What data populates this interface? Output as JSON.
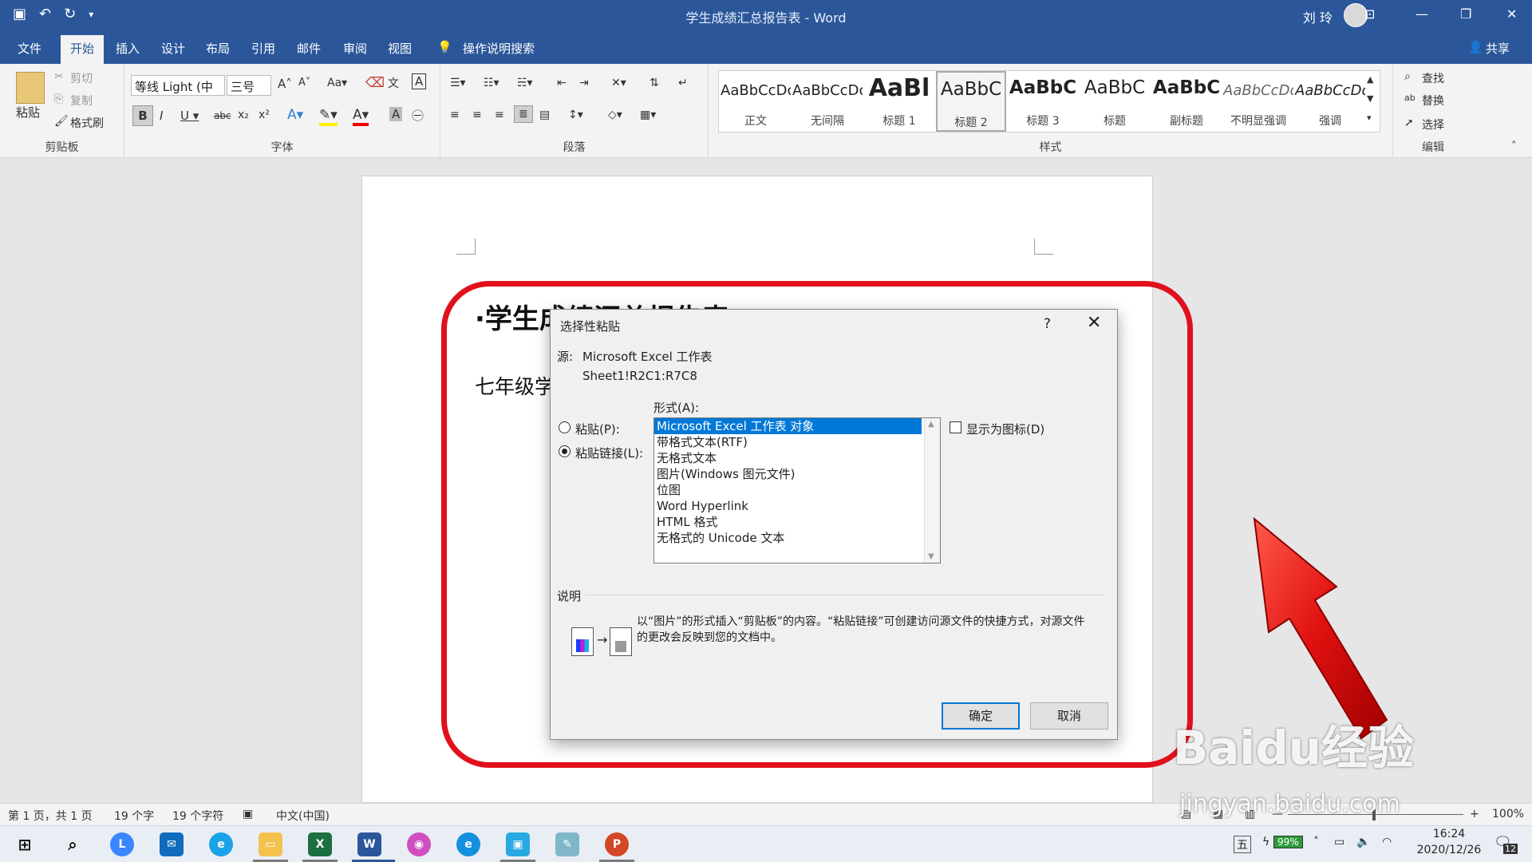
{
  "title_bar": {
    "title": "学生成绩汇总报告表  -  Word",
    "user": "刘 玲"
  },
  "tabs": [
    "文件",
    "开始",
    "插入",
    "设计",
    "布局",
    "引用",
    "邮件",
    "审阅",
    "视图",
    "操作说明搜索"
  ],
  "share_label": "共享",
  "ribbon": {
    "clipboard": {
      "paste": "粘贴",
      "cut": "剪切",
      "copy": "复制",
      "format_painter": "格式刷",
      "label": "剪贴板"
    },
    "font": {
      "name": "等线 Light (中",
      "size": "三号",
      "label": "字体"
    },
    "paragraph": {
      "label": "段落"
    },
    "styles": {
      "label": "样式",
      "items": [
        {
          "preview": "AaBbCcDc",
          "name": "正文"
        },
        {
          "preview": "AaBbCcDc",
          "name": "无间隔"
        },
        {
          "preview": "AaBl",
          "name": "标题 1"
        },
        {
          "preview": "AaBbC",
          "name": "标题 2"
        },
        {
          "preview": "AaBbC",
          "name": "标题 3"
        },
        {
          "preview": "AaBbC",
          "name": "标题"
        },
        {
          "preview": "AaBbC",
          "name": "副标题"
        },
        {
          "preview": "AaBbCcDc",
          "name": "不明显强调"
        },
        {
          "preview": "AaBbCcDc",
          "name": "强调"
        }
      ]
    },
    "editing": {
      "find": "查找",
      "replace": "替换",
      "select": "选择",
      "label": "编辑"
    }
  },
  "document": {
    "heading": "·学生成绩汇总报告表",
    "line2": "七年级学"
  },
  "dialog": {
    "title": "选择性粘贴",
    "help": "?",
    "source_label": "源:",
    "source_app": "Microsoft Excel 工作表",
    "source_range": "Sheet1!R2C1:R7C8",
    "format_label": "形式(A):",
    "paste_label": "粘贴(P):",
    "paste_link_label": "粘贴链接(L):",
    "formats": [
      "Microsoft Excel 工作表 对象",
      "带格式文本(RTF)",
      "无格式文本",
      "图片(Windows 图元文件)",
      "位图",
      "Word Hyperlink",
      "HTML 格式",
      "无格式的 Unicode 文本"
    ],
    "show_as_icon": "显示为图标(D)",
    "result_title": "说明",
    "result_text_1": "以“图片”的形式插入“剪贴板”的内容。“粘贴链接”可创建访问源文件的快捷方式，对源文件",
    "result_text_2": "的更改会反映到您的文档中。",
    "ok": "确定",
    "cancel": "取消"
  },
  "status_bar": {
    "page": "第 1 页，共 1 页",
    "words": "19 个字",
    "chars": "19 个字符",
    "lang": "中文(中国)",
    "zoom": "100%"
  },
  "taskbar": {
    "ime": "五",
    "battery": "99%",
    "time": "16:24",
    "date": "2020/12/26",
    "notifications": "12"
  },
  "watermark": {
    "brand": "Baidu经验",
    "url": "jingyan.baidu.com"
  },
  "colors": {
    "word_blue": "#2b579a",
    "highlight": "#0078d7",
    "annotation_red": "#e1101d"
  }
}
